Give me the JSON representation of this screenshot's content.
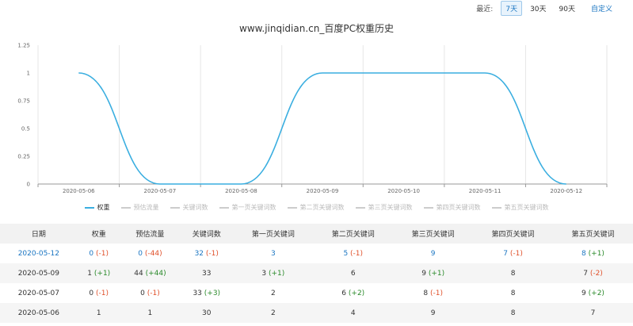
{
  "range": {
    "label": "最近:",
    "options": [
      "7天",
      "30天",
      "90天"
    ],
    "active": "7天",
    "custom": "自定义"
  },
  "title": "www.jinqidian.cn_百度PC权重历史",
  "chart_data": {
    "type": "line",
    "title": "www.jinqidian.cn_百度PC权重历史",
    "categories": [
      "2020-05-06",
      "2020-05-07",
      "2020-05-08",
      "2020-05-09",
      "2020-05-10",
      "2020-05-11",
      "2020-05-12"
    ],
    "series": [
      {
        "name": "权重",
        "values": [
          1,
          0,
          0,
          1,
          1,
          1,
          0
        ]
      }
    ],
    "y_ticks": [
      "0",
      "0.25",
      "0.5",
      "0.75",
      "1",
      "1.25"
    ],
    "ylim": [
      0,
      1.25
    ],
    "grid": "vertical",
    "legend": "bottom",
    "line_color": "#3aaee0",
    "legend_items": [
      {
        "label": "权重",
        "on": true
      },
      {
        "label": "预估流量",
        "on": false
      },
      {
        "label": "关键词数",
        "on": false
      },
      {
        "label": "第一页关键词数",
        "on": false
      },
      {
        "label": "第二页关键词数",
        "on": false
      },
      {
        "label": "第三页关键词数",
        "on": false
      },
      {
        "label": "第四页关键词数",
        "on": false
      },
      {
        "label": "第五页关键词数",
        "on": false
      }
    ]
  },
  "table": {
    "headers": [
      "日期",
      "权重",
      "预估流量",
      "关键词数",
      "第一页关键词",
      "第二页关键词",
      "第三页关键词",
      "第四页关键词",
      "第五页关键词"
    ],
    "rows": [
      [
        {
          "v": "2020-05-12",
          "c": "blue"
        },
        {
          "v": "0",
          "c": "blue",
          "d": "(-1)",
          "dc": "down"
        },
        {
          "v": "0",
          "c": "blue",
          "d": "(-44)",
          "dc": "down"
        },
        {
          "v": "32",
          "c": "blue",
          "d": "(-1)",
          "dc": "down"
        },
        {
          "v": "3",
          "c": "blue"
        },
        {
          "v": "5",
          "c": "blue",
          "d": "(-1)",
          "dc": "down"
        },
        {
          "v": "9",
          "c": "blue"
        },
        {
          "v": "7",
          "c": "blue",
          "d": "(-1)",
          "dc": "down"
        },
        {
          "v": "8",
          "c": "blue",
          "d": "(+1)",
          "dc": "up"
        }
      ],
      [
        {
          "v": "2020-05-09"
        },
        {
          "v": "1",
          "d": "(+1)",
          "dc": "up"
        },
        {
          "v": "44",
          "d": "(+44)",
          "dc": "up"
        },
        {
          "v": "33"
        },
        {
          "v": "3",
          "d": "(+1)",
          "dc": "up"
        },
        {
          "v": "6"
        },
        {
          "v": "9",
          "d": "(+1)",
          "dc": "up"
        },
        {
          "v": "8"
        },
        {
          "v": "7",
          "d": "(-2)",
          "dc": "down"
        }
      ],
      [
        {
          "v": "2020-05-07"
        },
        {
          "v": "0",
          "d": "(-1)",
          "dc": "down"
        },
        {
          "v": "0",
          "d": "(-1)",
          "dc": "down"
        },
        {
          "v": "33",
          "d": "(+3)",
          "dc": "up"
        },
        {
          "v": "2"
        },
        {
          "v": "6",
          "d": "(+2)",
          "dc": "up"
        },
        {
          "v": "8",
          "d": "(-1)",
          "dc": "down"
        },
        {
          "v": "8"
        },
        {
          "v": "9",
          "d": "(+2)",
          "dc": "up"
        }
      ],
      [
        {
          "v": "2020-05-06"
        },
        {
          "v": "1"
        },
        {
          "v": "1"
        },
        {
          "v": "30"
        },
        {
          "v": "2"
        },
        {
          "v": "4"
        },
        {
          "v": "9"
        },
        {
          "v": "8"
        },
        {
          "v": "7"
        }
      ]
    ]
  }
}
